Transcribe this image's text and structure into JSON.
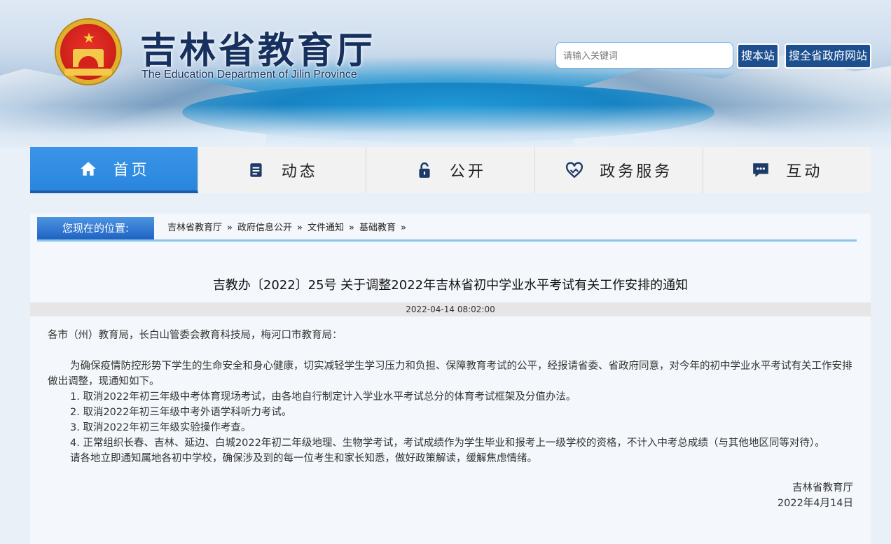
{
  "header": {
    "title": "吉林省教育厅",
    "subtitle": "The Education Department of Jilin Province",
    "search_placeholder": "请输入关键词",
    "search_site_label": "搜本站",
    "search_gov_label": "搜全省政府网站"
  },
  "nav": {
    "items": [
      {
        "label": "首页",
        "icon": "home-icon"
      },
      {
        "label": "动态",
        "icon": "news-icon"
      },
      {
        "label": "公开",
        "icon": "lock-icon"
      },
      {
        "label": "政务服务",
        "icon": "handshake-heart-icon"
      },
      {
        "label": "互动",
        "icon": "chat-icon"
      }
    ],
    "active_index": 0
  },
  "breadcrumb": {
    "label": "您现在的位置:",
    "items": [
      "吉林省教育厅",
      "政府信息公开",
      "文件通知",
      "基础教育"
    ],
    "separator": "»"
  },
  "article": {
    "title": "吉教办〔2022〕25号 关于调整2022年吉林省初中学业水平考试有关工作安排的通知",
    "date": "2022-04-14 08:02:00",
    "address": "各市（州）教育局，长白山管委会教育科技局，梅河口市教育局：",
    "paragraphs": [
      "为确保疫情防控形势下学生的生命安全和身心健康，切实减轻学生学习压力和负担、保障教育考试的公平，经报请省委、省政府同意，对今年的初中学业水平考试有关工作安排做出调整，现通知如下。",
      "1. 取消2022年初三年级中考体育现场考试，由各地自行制定计入学业水平考试总分的体育考试框架及分值办法。",
      "2. 取消2022年初三年级中考外语学科听力考试。",
      "3. 取消2022年初三年级实验操作考查。",
      "4. 正常组织长春、吉林、延边、白城2022年初二年级地理、生物学考试，考试成绩作为学生毕业和报考上一级学校的资格，不计入中考总成绩（与其他地区同等对待）。",
      "请各地立即通知属地各初中学校，确保涉及到的每一位考生和家长知悉，做好政策解读，缓解焦虑情绪。"
    ],
    "signature": "吉林省教育厅",
    "sign_date": "2022年4月14日"
  },
  "colors": {
    "brand_blue": "#1d4f8f",
    "nav_active": "#2a86dd",
    "title_navy": "#16315f"
  }
}
